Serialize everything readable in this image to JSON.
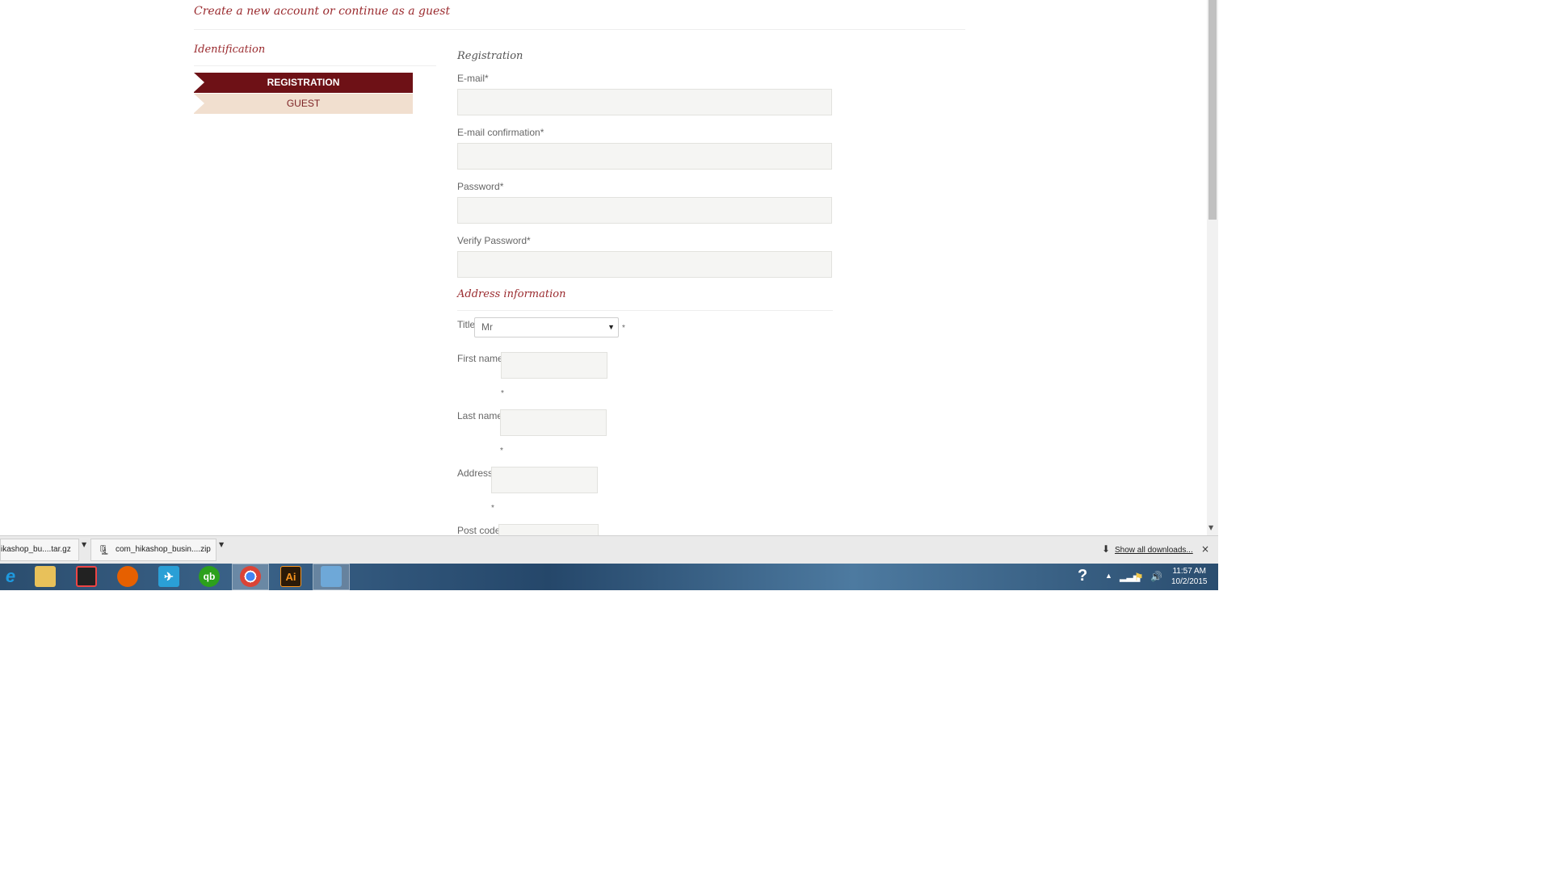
{
  "page": {
    "heading": "Create a new account or continue as a guest",
    "identification_title": "Identification",
    "tabs": [
      {
        "label": "REGISTRATION"
      },
      {
        "label": "GUEST"
      }
    ]
  },
  "registration": {
    "title": "Registration",
    "fields": [
      {
        "label": "E-mail*",
        "value": ""
      },
      {
        "label": "E-mail confirmation*",
        "value": ""
      },
      {
        "label": "Password*",
        "value": ""
      },
      {
        "label": "Verify Password*",
        "value": ""
      }
    ]
  },
  "address": {
    "title": "Address information",
    "title_field": {
      "label": "Title",
      "selected": "Mr",
      "required_mark": "*"
    },
    "first_name": {
      "label": "First name",
      "required_mark": "*"
    },
    "last_name": {
      "label": "Last name",
      "required_mark": "*"
    },
    "address": {
      "label": "Address",
      "required_mark": "*"
    },
    "post_code": {
      "label": "Post code"
    }
  },
  "downloads": {
    "items": [
      {
        "name": "ikashop_bu....tar.gz"
      },
      {
        "name": "com_hikashop_busin....zip"
      }
    ],
    "show_all": "Show all downloads...",
    "close_glyph": "×"
  },
  "taskbar": {
    "icons": [
      {
        "name": "internet-explorer-icon",
        "glyph": "e",
        "color": "#1e9ae0"
      },
      {
        "name": "file-explorer-icon",
        "glyph": "",
        "color": "#e8c15a"
      },
      {
        "name": "color-app-icon",
        "glyph": "",
        "color": "#222"
      },
      {
        "name": "firefox-icon",
        "glyph": "",
        "color": "#e66000"
      },
      {
        "name": "rocket-app-icon",
        "glyph": "",
        "color": "#2a9fd6"
      },
      {
        "name": "quickbooks-icon",
        "glyph": "qb",
        "color": "#2ca01c"
      },
      {
        "name": "chrome-icon",
        "glyph": "",
        "color": "#dddddd"
      },
      {
        "name": "illustrator-icon",
        "glyph": "Ai",
        "color": "#2b1a08"
      },
      {
        "name": "control-panel-icon",
        "glyph": "",
        "color": "#6ea8d8"
      }
    ],
    "clock_time": "11:57 AM",
    "clock_date": "10/2/2015"
  }
}
